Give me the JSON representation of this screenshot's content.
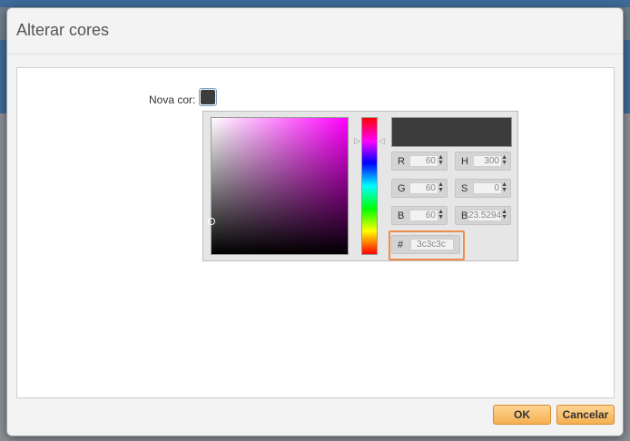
{
  "dialog": {
    "title": "Alterar cores",
    "ok_label": "OK",
    "cancel_label": "Cancelar"
  },
  "color_field": {
    "label": "Nova cor:",
    "current_color": "#3c3c3c"
  },
  "picker": {
    "hue_gradient": "magenta",
    "fields": {
      "r": {
        "label": "R",
        "value": "60"
      },
      "g": {
        "label": "G",
        "value": "60"
      },
      "b": {
        "label": "B",
        "value": "60"
      },
      "h": {
        "label": "H",
        "value": "300"
      },
      "s": {
        "label": "S",
        "value": "0"
      },
      "v": {
        "label": "B",
        "value": "23.5294"
      },
      "hex": {
        "label": "#",
        "value": "3c3c3c"
      }
    }
  },
  "colors": {
    "accent_button": "#f5b051",
    "highlight_border": "#f08c4a"
  }
}
